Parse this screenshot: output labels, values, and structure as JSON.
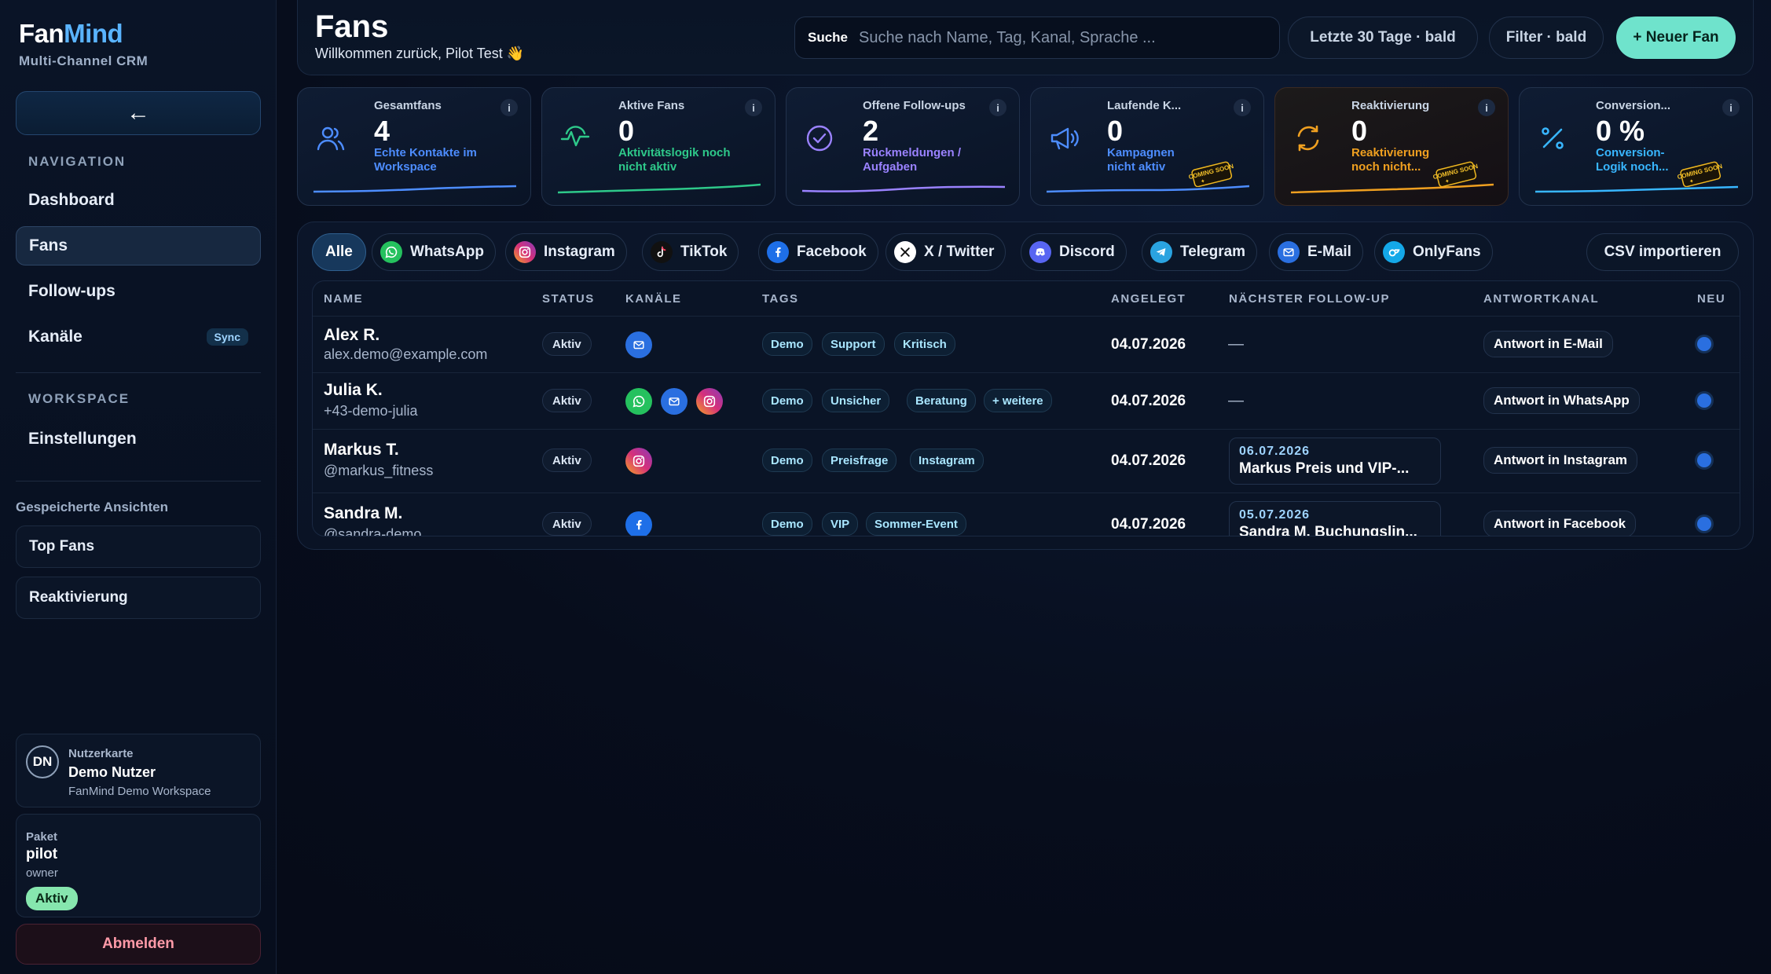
{
  "app": {
    "brand_part1": "Fan",
    "brand_part2": "Mind",
    "subtitle": "Multi-Channel CRM"
  },
  "sidebar": {
    "back_label": "←",
    "nav_heading": "NAVIGATION",
    "nav_items": [
      {
        "label": "Dashboard"
      },
      {
        "label": "Fans",
        "active": true
      },
      {
        "label": "Follow-ups"
      },
      {
        "label": "Kanäle",
        "badge": "Sync"
      }
    ],
    "workspace_heading": "WORKSPACE",
    "workspace_items": [
      {
        "label": "Einstellungen"
      }
    ],
    "saved_heading": "Gespeicherte Ansichten",
    "saved_views": [
      {
        "label": "Top Fans"
      },
      {
        "label": "Reaktivierung"
      }
    ],
    "user_card": {
      "initials": "DN",
      "label": "Nutzerkarte",
      "name": "Demo Nutzer",
      "workspace": "FanMind Demo Workspace"
    },
    "package": {
      "label": "Paket",
      "name": "pilot",
      "role": "owner",
      "status": "Aktiv"
    },
    "logout_label": "Abmelden"
  },
  "header": {
    "title": "Fans",
    "welcome": "Willkommen zurück, Pilot Test 👋",
    "search_label": "Suche",
    "search_placeholder": "Suche nach Name, Tag, Kanal, Sprache ...",
    "period_button": "Letzte 30 Tage · bald",
    "filter_button": "Filter · bald",
    "new_fan_button": "+ Neuer Fan"
  },
  "kpis": [
    {
      "label": "Gesamtfans",
      "value": "4",
      "sub": "Echte Kontakte im Workspace",
      "color": "#4d8dff",
      "icon": "users-icon",
      "info": "i"
    },
    {
      "label": "Aktive Fans",
      "value": "0",
      "sub": "Aktivitätslogik noch nicht aktiv",
      "color": "#2ec98a",
      "icon": "activity-icon",
      "info": "i"
    },
    {
      "label": "Offene Follow-ups",
      "value": "2",
      "sub": "Rückmeldungen / Aufgaben",
      "color": "#9a82ff",
      "icon": "check-circle-icon",
      "info": "i"
    },
    {
      "label": "Laufende K...",
      "value": "0",
      "sub": "Kampagnen nicht aktiv",
      "color": "#4d8dff",
      "icon": "megaphone-icon",
      "info": "i",
      "soon": "COMING SOON"
    },
    {
      "label": "Reaktivierung",
      "value": "0",
      "sub": "Reaktivierung noch nicht...",
      "color": "#f0a020",
      "icon": "refresh-icon",
      "info": "i",
      "soon": "COMING SOON"
    },
    {
      "label": "Conversion...",
      "value": "0 %",
      "sub": "Conversion-Logik noch...",
      "color": "#38b6ff",
      "icon": "percent-icon",
      "info": "i",
      "soon": "COMING SOON"
    }
  ],
  "channel_filters": [
    {
      "label": "Alle",
      "active": true
    },
    {
      "label": "WhatsApp",
      "icon": "whatsapp-icon",
      "color": "#25c15e"
    },
    {
      "label": "Instagram",
      "icon": "instagram-icon",
      "color": "#d6307a"
    },
    {
      "label": "TikTok",
      "icon": "tiktok-icon",
      "color": "#111111"
    },
    {
      "label": "Facebook",
      "icon": "facebook-icon",
      "color": "#1e6fe8"
    },
    {
      "label": "X / Twitter",
      "icon": "x-twitter-icon",
      "color": "#ffffff"
    },
    {
      "label": "Discord",
      "icon": "discord-icon",
      "color": "#5865f2"
    },
    {
      "label": "Telegram",
      "icon": "telegram-icon",
      "color": "#2aa3e0"
    },
    {
      "label": "E-Mail",
      "icon": "email-icon",
      "color": "#2a6fe0"
    },
    {
      "label": "OnlyFans",
      "icon": "onlyfans-icon",
      "color": "#14a8e8"
    }
  ],
  "csv_button": "CSV importieren",
  "table": {
    "columns": [
      "NAME",
      "STATUS",
      "KANÄLE",
      "TAGS",
      "ANGELEGT",
      "NÄCHSTER FOLLOW-UP",
      "ANTWORTKANAL",
      "NEU"
    ],
    "rows": [
      {
        "name": "Alex R.",
        "contact": "alex.demo@example.com",
        "status": "Aktiv",
        "channels": [
          "email-icon"
        ],
        "tags": [
          "Demo",
          "Support",
          "Kritisch"
        ],
        "created": "04.07.2026",
        "followup": "—",
        "reply": "Antwort in E-Mail"
      },
      {
        "name": "Julia K.",
        "contact": "+43-demo-julia",
        "status": "Aktiv",
        "channels": [
          "whatsapp-icon",
          "email-icon",
          "instagram-icon"
        ],
        "tags": [
          "Demo",
          "Unsicher",
          "Beratung",
          "+ weitere"
        ],
        "created": "04.07.2026",
        "followup": "—",
        "reply": "Antwort in WhatsApp"
      },
      {
        "name": "Markus T.",
        "contact": "@markus_fitness",
        "status": "Aktiv",
        "channels": [
          "instagram-icon"
        ],
        "tags": [
          "Demo",
          "Preisfrage",
          "Instagram"
        ],
        "created": "04.07.2026",
        "followup_date": "06.07.2026",
        "followup_text": "Markus Preis und VIP-...",
        "reply": "Antwort in Instagram"
      },
      {
        "name": "Sandra M.",
        "contact": "@sandra-demo",
        "status": "Aktiv",
        "channels": [
          "facebook-icon"
        ],
        "tags": [
          "Demo",
          "VIP",
          "Sommer-Event"
        ],
        "created": "04.07.2026",
        "followup_date": "05.07.2026",
        "followup_text": "Sandra M. Buchungslin...",
        "reply": "Antwort in Facebook"
      }
    ]
  }
}
